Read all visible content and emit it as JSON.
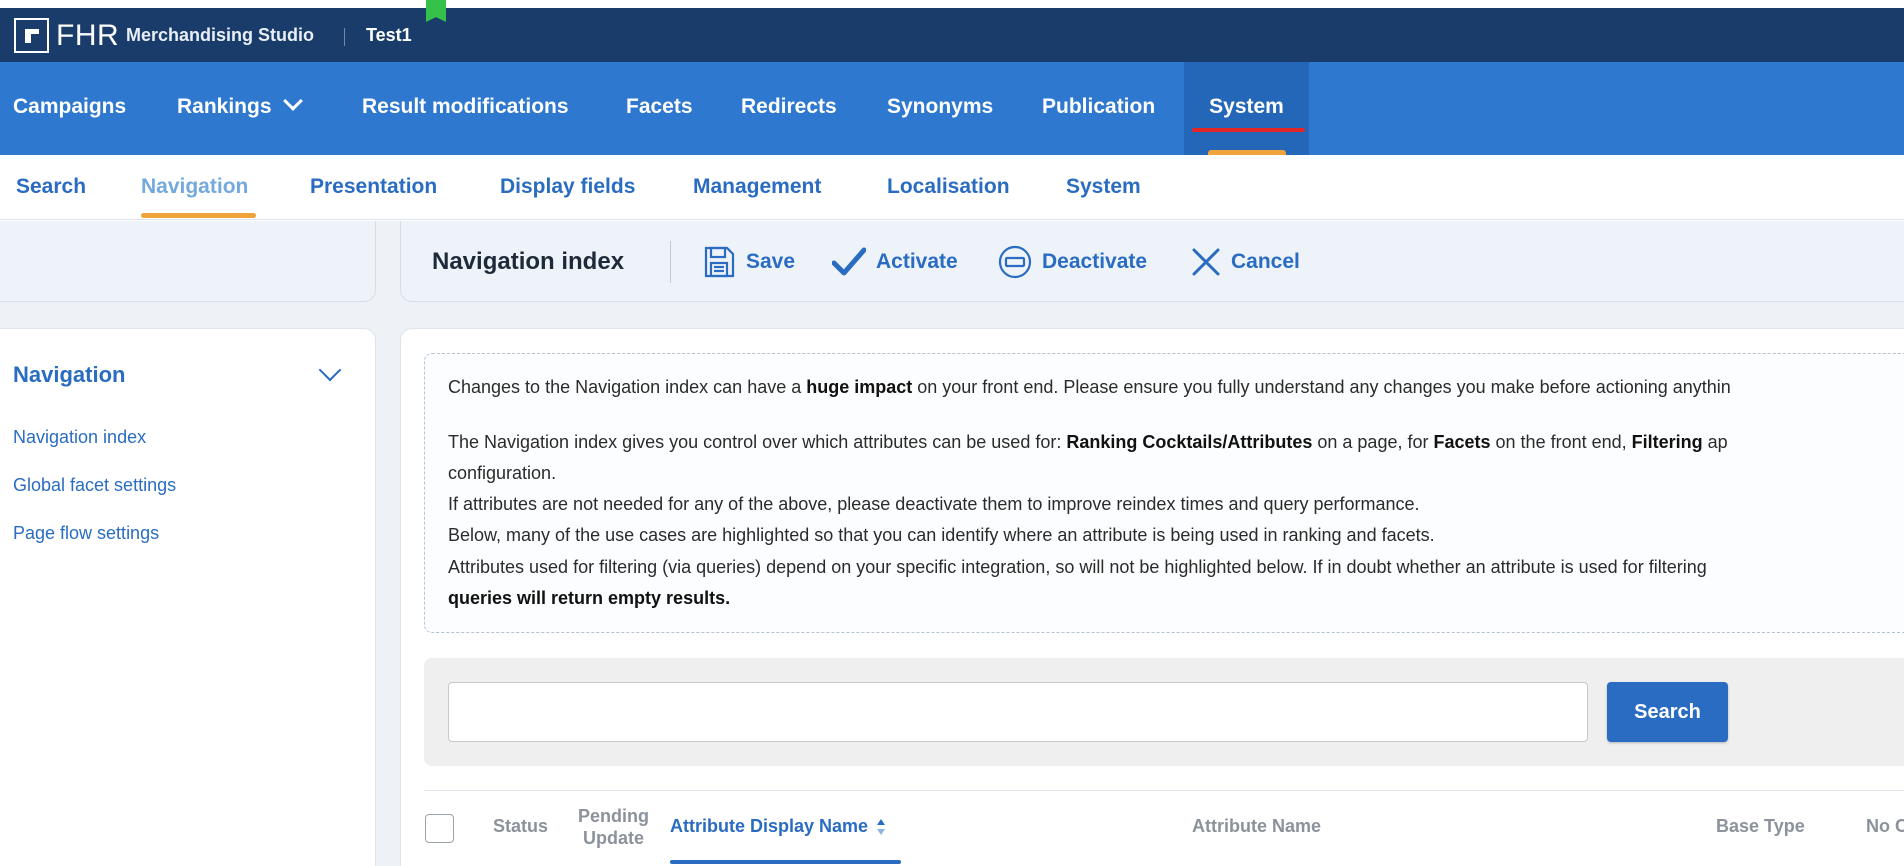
{
  "topbar": {
    "logo_text": "FHR",
    "app_name": "Merchandising Studio",
    "environment": "Test1"
  },
  "main_nav": {
    "items": [
      {
        "label": "Campaigns"
      },
      {
        "label": "Rankings"
      },
      {
        "label": "Result modifications"
      },
      {
        "label": "Facets"
      },
      {
        "label": "Redirects"
      },
      {
        "label": "Synonyms"
      },
      {
        "label": "Publication"
      },
      {
        "label": "System"
      }
    ],
    "active": "System"
  },
  "sub_nav": {
    "items": [
      {
        "label": "Search"
      },
      {
        "label": "Navigation"
      },
      {
        "label": "Presentation"
      },
      {
        "label": "Display fields"
      },
      {
        "label": "Management"
      },
      {
        "label": "Localisation"
      },
      {
        "label": "System"
      }
    ],
    "active": "Navigation"
  },
  "toolbar": {
    "title": "Navigation index",
    "save_label": "Save",
    "activate_label": "Activate",
    "deactivate_label": "Deactivate",
    "cancel_label": "Cancel"
  },
  "sidebar": {
    "title": "Navigation",
    "links": [
      "Navigation index",
      "Global facet settings",
      "Page flow settings"
    ]
  },
  "notice": {
    "line1_pre": "Changes to the Navigation index can have a ",
    "line1_bold": "huge impact",
    "line1_post": " on your front end. Please ensure you fully understand any changes you make before actioning anythin",
    "line2_pre": "The Navigation index gives you control over which attributes can be used for: ",
    "line2_bold1": "Ranking Cocktails/Attributes",
    "line2_mid1": " on a page, for ",
    "line2_bold2": "Facets",
    "line2_mid2": " on the front end, ",
    "line2_bold3": "Filtering",
    "line2_post": " ap",
    "line3": "configuration.",
    "line4": "If attributes are not needed for any of the above, please deactivate them to improve reindex times and query performance.",
    "line5": "Below, many of the use cases are highlighted so that you can identify where an attribute is being used in ranking and facets.",
    "line6": "Attributes used for filtering (via queries) depend on your specific integration, so will not be highlighted below. If in doubt whether an attribute is used for filtering",
    "line7_bold": "queries will return empty results."
  },
  "search": {
    "value": "",
    "placeholder": "",
    "button_label": "Search"
  },
  "table": {
    "headers": {
      "status": "Status",
      "pending_line1": "Pending",
      "pending_line2": "Update",
      "display_name": "Attribute Display Name",
      "attribute_name": "Attribute Name",
      "base_type": "Base Type",
      "no_c": "No C"
    },
    "sorted_column": "Attribute Display Name"
  },
  "colors": {
    "topbar": "#1a3c6a",
    "nav": "#2e78d0",
    "accent": "#2a6cc2",
    "highlight_orange": "#f0a23b",
    "annotation_red": "#e32626",
    "flag_green": "#36c24a"
  }
}
